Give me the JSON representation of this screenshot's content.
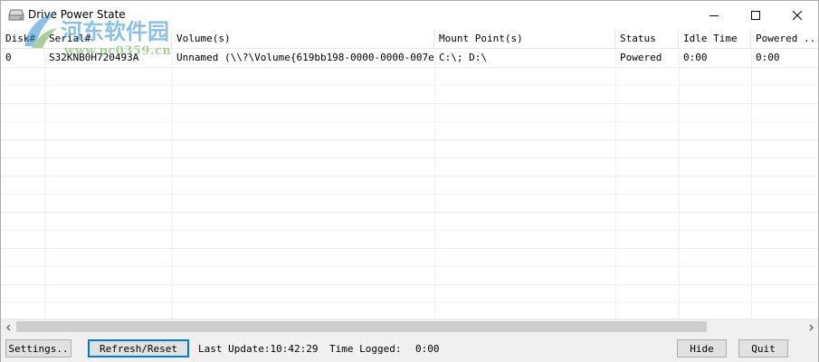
{
  "window": {
    "title": "Drive Power State"
  },
  "watermark": {
    "site_name": "河东软件园",
    "url": "www.pc0359.cn"
  },
  "columns": [
    {
      "key": "disk",
      "label": "Disk#"
    },
    {
      "key": "serial",
      "label": "Serial#"
    },
    {
      "key": "volumes",
      "label": "Volume(s)"
    },
    {
      "key": "mount",
      "label": "Mount Point(s)"
    },
    {
      "key": "status",
      "label": "Status"
    },
    {
      "key": "idle",
      "label": "Idle Time"
    },
    {
      "key": "powered",
      "label": "Powered ..."
    }
  ],
  "rows": [
    {
      "disk": "0",
      "serial": "S32KNB0H720493A",
      "volumes": "Unnamed (\\\\?\\Volume{619bb198-0000-0000-007e...",
      "mount": "C:\\; D:\\",
      "status": "Powered",
      "idle": "0:00",
      "powered": "0:00"
    }
  ],
  "footer": {
    "settings_label": "Settings..",
    "refresh_label": "Refresh/Reset",
    "last_update_label": "Last Update:10:42:29",
    "time_logged_label": "Time Logged:",
    "time_logged_value": "0:00",
    "hide_label": "Hide",
    "quit_label": "Quit"
  },
  "colors": {
    "focus_border": "#0078d7",
    "watermark_blue": "#2d8fd0",
    "watermark_green": "#6aa84f"
  }
}
